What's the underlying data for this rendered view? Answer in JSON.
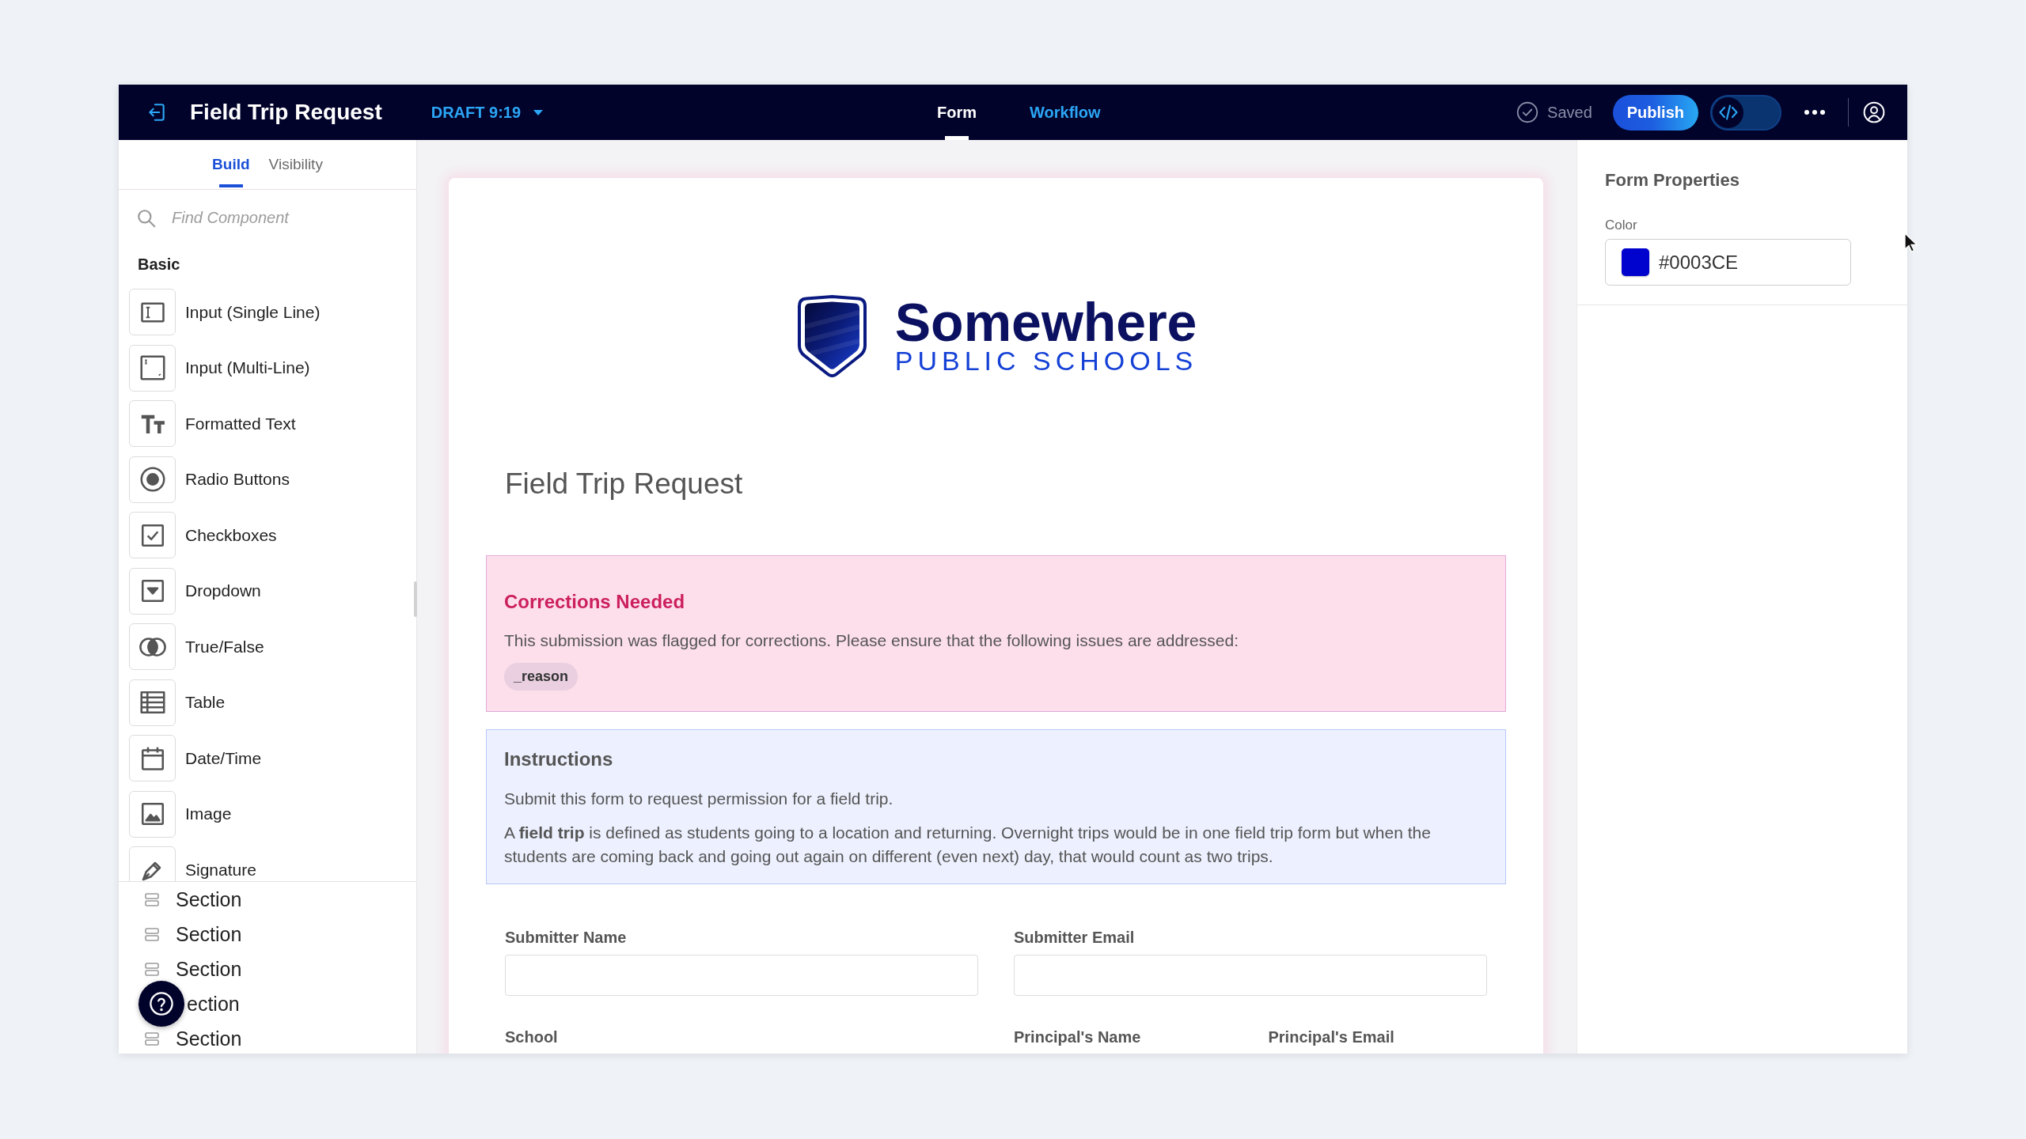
{
  "top_bar": {
    "title": "Field Trip Request",
    "version": "DRAFT 9:19",
    "tabs": [
      {
        "label": "Form",
        "selected": true
      },
      {
        "label": "Workflow",
        "selected": false
      }
    ],
    "save_status": "Saved",
    "publish_button": "Publish",
    "code_view": {
      "on": false
    }
  },
  "sidebar": {
    "tabs": [
      {
        "label": "Build",
        "selected": true
      },
      {
        "label": "Visibility",
        "selected": false
      }
    ],
    "search": {
      "placeholder": "Find Component"
    },
    "group_title": "Basic",
    "components": [
      {
        "label": "Input (Single Line)",
        "kind": "single-line"
      },
      {
        "label": "Input (Multi-Line)",
        "kind": "multi-line"
      },
      {
        "label": "Formatted Text",
        "kind": "formatted-text"
      },
      {
        "label": "Radio Buttons",
        "kind": "radio"
      },
      {
        "label": "Checkboxes",
        "kind": "checkbox"
      },
      {
        "label": "Dropdown",
        "kind": "dropdown"
      },
      {
        "label": "True/False",
        "kind": "true-false"
      },
      {
        "label": "Table",
        "kind": "table"
      },
      {
        "label": "Date/Time",
        "kind": "datetime"
      },
      {
        "label": "Image",
        "kind": "image"
      },
      {
        "label": "Signature",
        "kind": "signature"
      }
    ],
    "sections": [
      {
        "label": "Section",
        "kind": "section"
      },
      {
        "label": "Section",
        "kind": "section"
      },
      {
        "label": "Section",
        "kind": "section"
      },
      {
        "label": "ection",
        "kind": "under-help-button"
      },
      {
        "label": "Section",
        "kind": "section"
      }
    ]
  },
  "form": {
    "logo": {
      "name": "Somewhere",
      "tagline": "PUBLIC SCHOOLS"
    },
    "title": "Field Trip Request",
    "corrections": {
      "title": "Corrections Needed",
      "text": "This submission was flagged for corrections. Please ensure that the following issues are addressed:",
      "tag": "_reason"
    },
    "instructions": {
      "title": "Instructions",
      "paragraphs": [
        "Submit this form to request permission for a field trip.",
        "A **field trip** is defined as students going to a location and returning. Overnight trips would be in one field trip form but when the students are coming back and going out again on different (even next) day, that would count as two trips."
      ]
    },
    "field_rows": [
      [
        {
          "label": "Submitter Name"
        },
        {
          "label": "Submitter Email"
        }
      ],
      [
        {
          "label": "School"
        },
        {
          "label": "Principal's Name"
        },
        {
          "label": "Principal's Email"
        }
      ]
    ]
  },
  "properties_panel": {
    "title": "Form Properties",
    "color_label": "Color",
    "color_value": "#0003CE"
  }
}
